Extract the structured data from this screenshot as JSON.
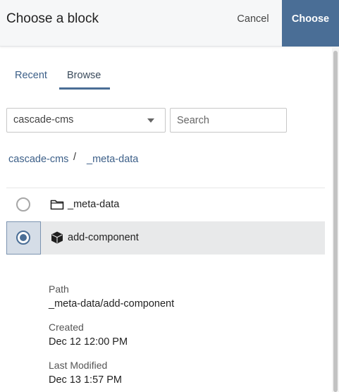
{
  "header": {
    "title": "Choose a block",
    "cancel_label": "Cancel",
    "choose_label": "Choose",
    "accent_color": "#4a6e96"
  },
  "tabs": [
    {
      "label": "Recent",
      "active": false
    },
    {
      "label": "Browse",
      "active": true
    }
  ],
  "filters": {
    "site_selected": "cascade-cms",
    "search_placeholder": "Search",
    "search_value": ""
  },
  "breadcrumb": {
    "root": "cascade-cms",
    "separator": "/",
    "current": "_meta-data"
  },
  "items": [
    {
      "label": "_meta-data",
      "type": "folder",
      "icon": "folder-icon",
      "selected": false
    },
    {
      "label": "add-component",
      "type": "block",
      "icon": "block-cube-icon",
      "selected": true
    }
  ],
  "details": {
    "path_label": "Path",
    "path_value": "_meta-data/add-component",
    "created_label": "Created",
    "created_value": "Dec 12 12:00 PM",
    "modified_label": "Last Modified",
    "modified_value": "Dec 13 1:57 PM"
  }
}
